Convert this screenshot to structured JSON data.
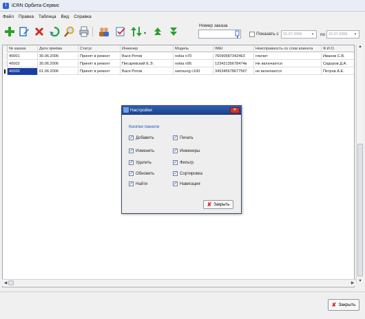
{
  "window": {
    "title": "iCRN Орбита-Сервис"
  },
  "menu": [
    "Файл",
    "Правка",
    "Таблица",
    "Вид",
    "Справка"
  ],
  "toolbar": {
    "buttons": [
      {
        "name": "add-icon",
        "color": "#2e9e2e"
      },
      {
        "name": "edit-icon",
        "color": "#1e6fc8"
      },
      {
        "name": "delete-icon",
        "color": "#d12b1f"
      },
      {
        "name": "refresh-icon",
        "color": "#2aa34a"
      },
      {
        "name": "find-icon",
        "color": "#d9a520"
      },
      {
        "name": "print-icon",
        "color": "#6b7a8c"
      },
      {
        "name": "engineers-icon",
        "color": "#c06a1a"
      },
      {
        "name": "filter-icon",
        "color": "#3b6ec6"
      },
      {
        "name": "sort-icon",
        "color": "#2e9e2e"
      },
      {
        "name": "navigate-up-icon",
        "color": "#2e9e2e"
      },
      {
        "name": "navigate-down-icon",
        "color": "#2e9e2e"
      }
    ],
    "order_label": "Номер заказа",
    "order_value": "",
    "show_label": "Показать с",
    "date_from": "15.07.2006",
    "po_label": "по",
    "date_to": "15.07.2006"
  },
  "grid": {
    "columns": [
      "№ заказа",
      "Дата приёма",
      "Статус",
      "Инженер",
      "Модель",
      "IMEI",
      "Неисправность со слов клиента",
      "Ф.И.О."
    ],
    "rows": [
      [
        "40001",
        "30.06.2006",
        "Принят в ремонт",
        "Вася Ротов",
        "nokia n70",
        "76090587342463",
        "глючит",
        "Иванов С.В."
      ],
      [
        "40002",
        "30.06.2006",
        "Принят в ремонт",
        "Писаревский Е.Э.",
        "nokia n95",
        "12342135678474в",
        "Не включается",
        "Сидоров Д.А."
      ],
      [
        "40000",
        "01.06.2006",
        "Принят в ремонт",
        "Вася Ротов",
        "samsung c100",
        "345345678677567",
        "не включается",
        "Петров А.Е."
      ]
    ],
    "selected_row": 2
  },
  "dialog": {
    "title": "Настройки",
    "section": "Кнопки панели",
    "left_options": [
      "Добавить",
      "Изменить",
      "Удалить",
      "Обновить",
      "Найти"
    ],
    "right_options": [
      "Печать",
      "Инженеры",
      "Фильтр",
      "Сортировка",
      "Навигация"
    ],
    "close_label": "Закрыть"
  },
  "footer": {
    "close_label": "Закрыть"
  }
}
